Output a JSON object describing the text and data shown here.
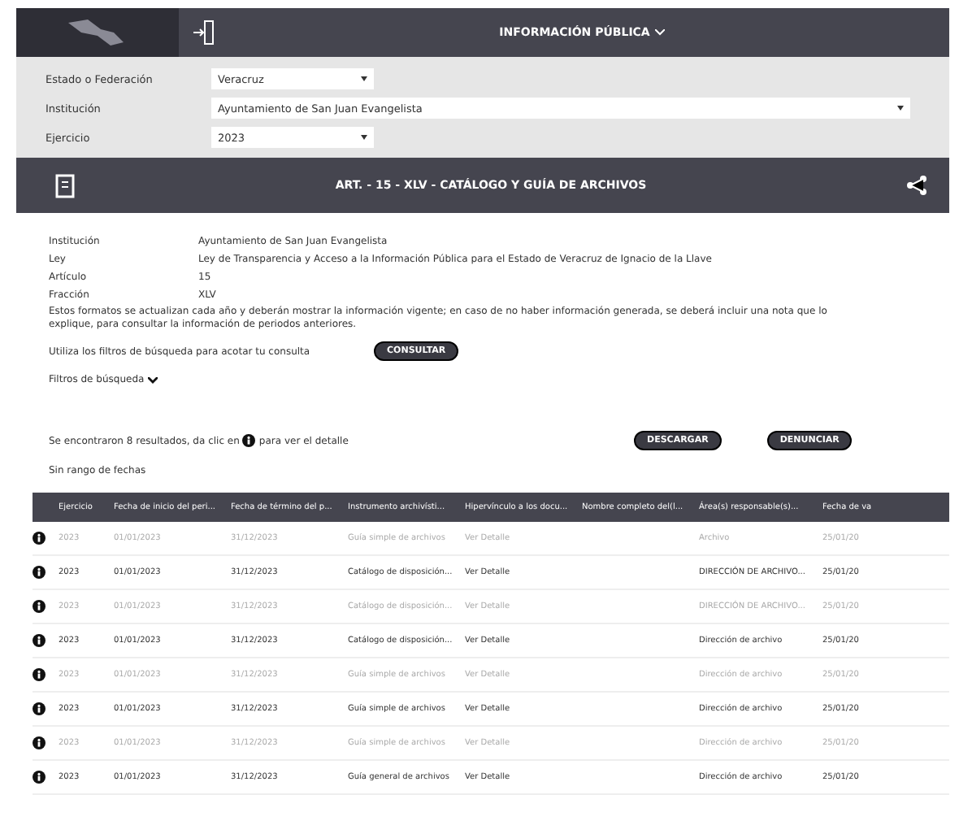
{
  "top_bar": {
    "title": "INFORMACIÓN PÚBLICA"
  },
  "filters": [
    {
      "label": "Estado o Federación",
      "value": "Veracruz",
      "wide": false
    },
    {
      "label": "Institución",
      "value": "Ayuntamiento de San Juan Evangelista",
      "wide": true
    },
    {
      "label": "Ejercicio",
      "value": "2023",
      "wide": false
    }
  ],
  "section_bar": {
    "title": "ART. - 15 - XLV - CATÁLOGO Y GUÍA DE ARCHIVOS"
  },
  "details": [
    {
      "label": "Institución",
      "value": "Ayuntamiento de San Juan Evangelista"
    },
    {
      "label": "Ley",
      "value": "Ley de Transparencia y Acceso a la Información Pública para el Estado de Veracruz de Ignacio de la Llave"
    },
    {
      "label": "Artículo",
      "value": "15"
    },
    {
      "label": "Fracción",
      "value": "XLV"
    }
  ],
  "note": "Estos formatos se actualizan cada año y deberán mostrar la información vigente; en caso de no haber información generada, se deberá incluir una nota que lo explique, para consultar la información de periodos anteriores.",
  "search_hint": "Utiliza los filtros de búsqueda para acotar tu consulta",
  "consult_button": "CONSULTAR",
  "filters_toggle": {
    "label": "Filtros de búsqueda",
    "expanded": false
  },
  "results_text": "Se encontraron 8 resultados, da clic en",
  "results_text_end": "para ver el detalle",
  "download_button": "DESCARGAR",
  "report_button": "DENUNCIAR",
  "date_range": "Sin rango de fechas",
  "table": {
    "columns": [
      "Ejercicio",
      "Fecha de inicio del peri...",
      "Fecha de término del p...",
      "Instrumento archivísti...",
      "Hipervínculo a los docu...",
      "Nombre completo del(l...",
      "Área(s) responsable(s)...",
      "Fecha de va"
    ],
    "rows": [
      {
        "cells": [
          "2023",
          "01/01/2023",
          "31/12/2023",
          "Guía simple de archivos",
          "Ver Detalle",
          "",
          "Archivo",
          "25/01/20"
        ]
      },
      {
        "cells": [
          "2023",
          "01/01/2023",
          "31/12/2023",
          "Catálogo de disposición...",
          "Ver Detalle",
          "",
          "DIRECCIÓN DE ARCHIVO...",
          "25/01/20"
        ]
      },
      {
        "cells": [
          "2023",
          "01/01/2023",
          "31/12/2023",
          "Catálogo de disposición...",
          "Ver Detalle",
          "",
          "DIRECCIÓN DE ARCHIVO...",
          "25/01/20"
        ]
      },
      {
        "cells": [
          "2023",
          "01/01/2023",
          "31/12/2023",
          "Catálogo de disposición...",
          "Ver Detalle",
          "",
          "Dirección de archivo",
          "25/01/20"
        ]
      },
      {
        "cells": [
          "2023",
          "01/01/2023",
          "31/12/2023",
          "Guía simple de archivos",
          "Ver Detalle",
          "",
          "Dirección de archivo",
          "25/01/20"
        ]
      },
      {
        "cells": [
          "2023",
          "01/01/2023",
          "31/12/2023",
          "Guía simple de archivos",
          "Ver Detalle",
          "",
          "Dirección de archivo",
          "25/01/20"
        ]
      },
      {
        "cells": [
          "2023",
          "01/01/2023",
          "31/12/2023",
          "Guía simple de archivos",
          "Ver Detalle",
          "",
          "Dirección de archivo",
          "25/01/20"
        ]
      },
      {
        "cells": [
          "2023",
          "01/01/2023",
          "31/12/2023",
          "Guía general de archivos",
          "Ver Detalle",
          "",
          "Dirección de archivo",
          "25/01/20"
        ]
      }
    ]
  }
}
